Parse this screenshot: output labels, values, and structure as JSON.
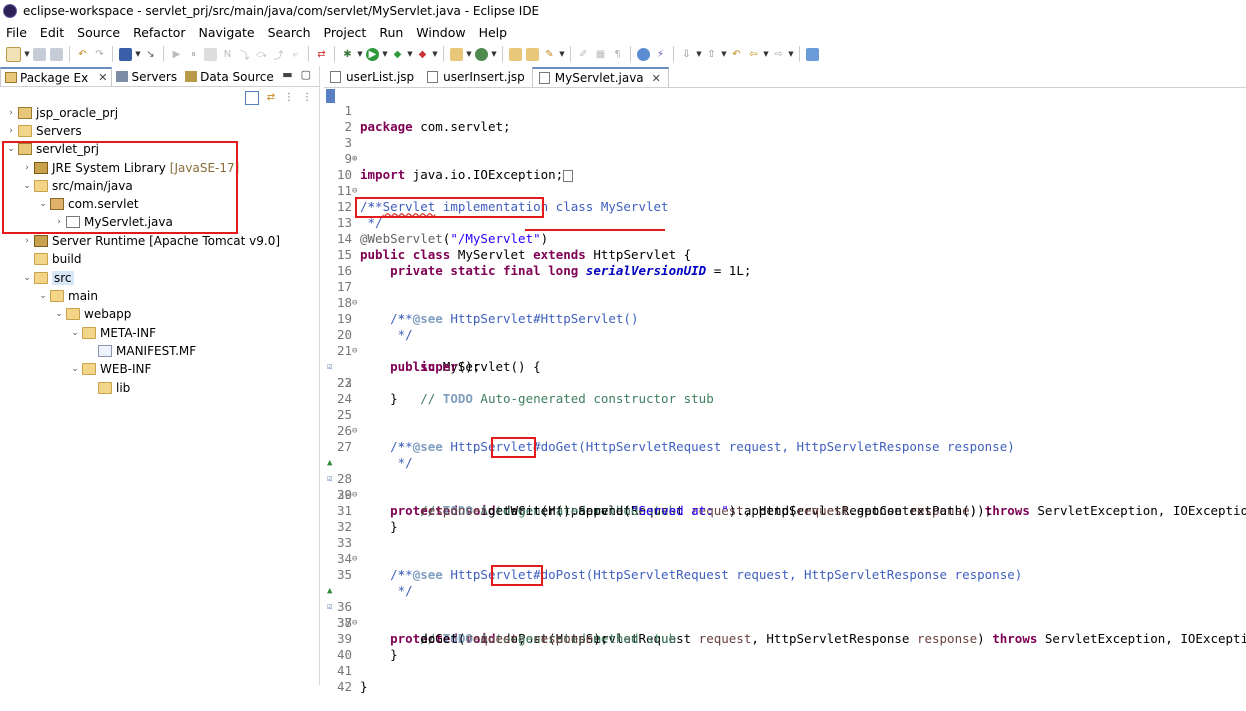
{
  "window": {
    "title": "eclipse-workspace - servlet_prj/src/main/java/com/servlet/MyServlet.java - Eclipse IDE"
  },
  "menu": [
    "File",
    "Edit",
    "Source",
    "Refactor",
    "Navigate",
    "Search",
    "Project",
    "Run",
    "Window",
    "Help"
  ],
  "left_panel": {
    "tabs": [
      {
        "label": "Package Ex",
        "close": "✕"
      },
      {
        "label": "Servers"
      },
      {
        "label": "Data Source"
      }
    ],
    "tree": [
      {
        "label": "jsp_oracle_prj",
        "twisty": "›"
      },
      {
        "label": "Servers",
        "twisty": "›"
      },
      {
        "label": "servlet_prj",
        "twisty": "⌄"
      },
      {
        "label": "JRE System Library",
        "extra": "[JavaSE-17]",
        "twisty": "›"
      },
      {
        "label": "src/main/java",
        "twisty": "⌄"
      },
      {
        "label": "com.servlet",
        "twisty": "⌄"
      },
      {
        "label": "MyServlet.java",
        "twisty": "›"
      },
      {
        "label": "Server Runtime [Apache Tomcat v9.0]",
        "twisty": "›"
      },
      {
        "label": "build",
        "twisty": ""
      },
      {
        "label": "src",
        "twisty": "⌄"
      },
      {
        "label": "main",
        "twisty": "⌄"
      },
      {
        "label": "webapp",
        "twisty": "⌄"
      },
      {
        "label": "META-INF",
        "twisty": "⌄"
      },
      {
        "label": "MANIFEST.MF",
        "twisty": ""
      },
      {
        "label": "WEB-INF",
        "twisty": "⌄"
      },
      {
        "label": "lib",
        "twisty": ""
      }
    ]
  },
  "editor": {
    "tabs": [
      {
        "label": "userList.jsp"
      },
      {
        "label": "userInsert.jsp"
      },
      {
        "label": "MyServlet.java",
        "close": "✕"
      }
    ],
    "lines": [
      {
        "n": "1"
      },
      {
        "n": "2"
      },
      {
        "n": "3"
      },
      {
        "n": "9"
      },
      {
        "n": "10"
      },
      {
        "n": "11"
      },
      {
        "n": "12"
      },
      {
        "n": "13"
      },
      {
        "n": "14"
      },
      {
        "n": "15"
      },
      {
        "n": "16"
      },
      {
        "n": "17"
      },
      {
        "n": "18"
      },
      {
        "n": "19"
      },
      {
        "n": "20"
      },
      {
        "n": "21"
      },
      {
        "n": "22"
      },
      {
        "n": "23"
      },
      {
        "n": "24"
      },
      {
        "n": "25"
      },
      {
        "n": "26"
      },
      {
        "n": "27"
      },
      {
        "n": "28"
      },
      {
        "n": "29"
      },
      {
        "n": "30"
      },
      {
        "n": "31"
      },
      {
        "n": "32"
      },
      {
        "n": "33"
      },
      {
        "n": "34"
      },
      {
        "n": "35"
      },
      {
        "n": "36"
      },
      {
        "n": "37"
      },
      {
        "n": "38"
      },
      {
        "n": "39"
      },
      {
        "n": "40"
      },
      {
        "n": "41"
      },
      {
        "n": "42"
      }
    ],
    "code": {
      "l1_kw": "package",
      "l1_rest": " com.servlet;",
      "l3_kw": "import",
      "l3_rest": " java.io.IOException;",
      "l10": "/**",
      "l11_a": " * ",
      "l11_b": "Servlet",
      "l11_c": " implementation class MyServlet",
      "l12": " */",
      "l13_ann": "@WebServlet",
      "l13_p1": "(",
      "l13_str": "\"/MyServlet\"",
      "l13_p2": ")",
      "l14_kw1": "public",
      "l14_kw2": "class",
      "l14_name": " MyServlet ",
      "l14_kw3": "extends",
      "l14_rest": " HttpServlet {",
      "l15_kw": "private static final long",
      "l15_fld": "serialVersionUID",
      "l15_rest": " = 1L;",
      "l17": "/**",
      "l18_a": " * ",
      "l18_tag": "@see",
      "l18_b": " HttpServlet#HttpServlet()",
      "l19": " */",
      "l20_kw": "public",
      "l20_rest": " MyServlet() {",
      "l21_kw": "super",
      "l21_rest": "();",
      "l22_a": "// ",
      "l22_todo": "TODO",
      "l22_b": " Auto-generated constructor stub",
      "l23": "}",
      "l25": "/**",
      "l26_a": " * ",
      "l26_tag": "@see",
      "l26_b": " HttpServlet#doGet(HttpServletRequest request, HttpServletResponse response)",
      "l27": " */",
      "l28_kw": "protected void",
      "l28_m": "doGet",
      "l28_a": "(HttpServletRequest ",
      "l28_p1": "request",
      "l28_b": ", HttpServletResponse ",
      "l28_p2": "response",
      "l28_c": ") ",
      "l28_kw2": "throws",
      "l28_d": " ServletException, IOException {",
      "l29_a": "// ",
      "l29_todo": "TODO",
      "l29_b": " Auto-generated method stub",
      "l30_p": "response",
      "l30_a": ".getWriter().append(",
      "l30_str": "\"Served at: \"",
      "l30_b": ").append(",
      "l30_p2": "request",
      "l30_c": ".getContextPath());",
      "l31": "}",
      "l33": "/**",
      "l34_a": " * ",
      "l34_tag": "@see",
      "l34_b": " HttpServlet#doPost(HttpServletRequest request, HttpServletResponse response)",
      "l35": " */",
      "l36_kw": "protected void",
      "l36_m": "doPost",
      "l36_a": "(HttpServletRequest ",
      "l36_p1": "request",
      "l36_b": ", HttpServletResponse ",
      "l36_p2": "response",
      "l36_c": ") ",
      "l36_kw2": "throws",
      "l36_d": " ServletException, IOException {",
      "l37_a": "// ",
      "l37_todo": "TODO",
      "l37_b": " Auto-generated method stub",
      "l38_a": "doGet(",
      "l38_p1": "request",
      "l38_b": ", ",
      "l38_p2": "response",
      "l38_c": ");",
      "l39": "}",
      "l41": "}"
    }
  },
  "colors": {
    "highlight_box": "#e51b1b",
    "keyword": "#7f0055",
    "string": "#2a00ff",
    "javadoc": "#3f5fbf",
    "comment": "#3f7f5f"
  }
}
